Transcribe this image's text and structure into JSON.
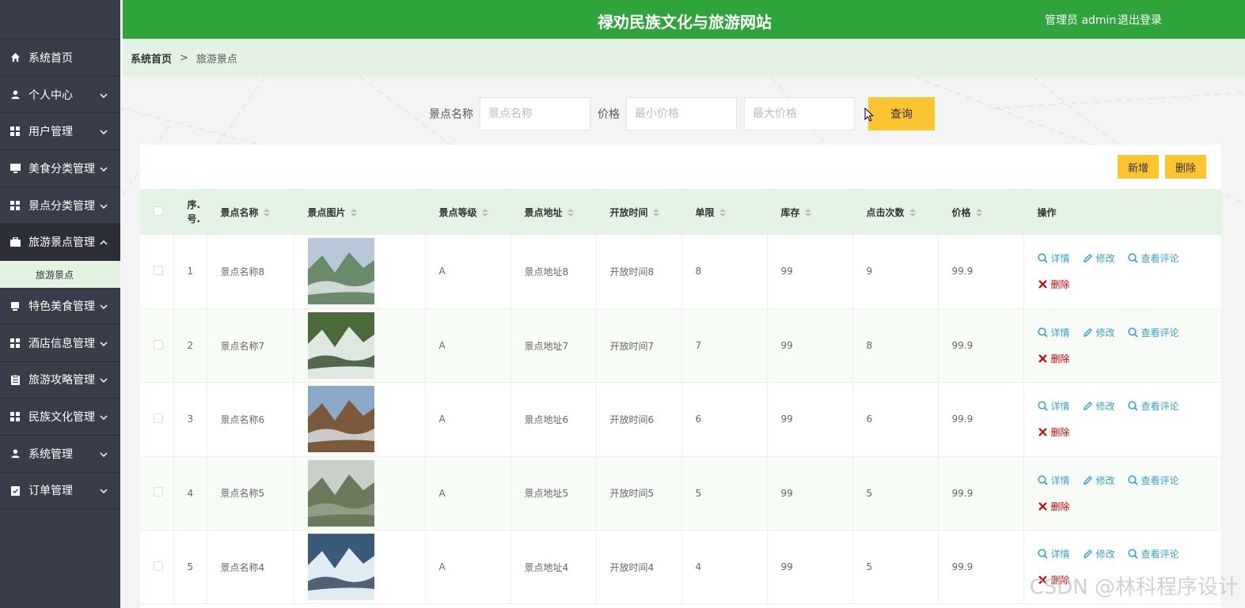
{
  "header": {
    "title": "禄劝民族文化与旅游网站",
    "user": "管理员 admin",
    "logout": "退出登录"
  },
  "sidebar": {
    "items": [
      {
        "label": "系统首页",
        "icon": "home-icon",
        "chevron": false
      },
      {
        "label": "个人中心",
        "icon": "user-icon",
        "chevron": true
      },
      {
        "label": "用户管理",
        "icon": "grid-icon",
        "chevron": true
      },
      {
        "label": "美食分类管理",
        "icon": "monitor-icon",
        "chevron": true
      },
      {
        "label": "景点分类管理",
        "icon": "grid-icon",
        "chevron": true
      },
      {
        "label": "旅游景点管理",
        "icon": "briefcase-icon",
        "chevron": true,
        "expanded": true
      },
      {
        "label": "特色美食管理",
        "icon": "card-icon",
        "chevron": true
      },
      {
        "label": "酒店信息管理",
        "icon": "grid-icon",
        "chevron": true
      },
      {
        "label": "旅游攻略管理",
        "icon": "clipboard-icon",
        "chevron": true
      },
      {
        "label": "民族文化管理",
        "icon": "grid-icon",
        "chevron": true
      },
      {
        "label": "系统管理",
        "icon": "user-icon",
        "chevron": true
      },
      {
        "label": "订单管理",
        "icon": "clipboard-check-icon",
        "chevron": true
      }
    ],
    "sub_item": "旅游景点"
  },
  "breadcrumb": {
    "home": "系统首页",
    "separator": ">",
    "current": "旅游景点"
  },
  "search": {
    "name_label": "景点名称",
    "name_placeholder": "景点名称",
    "price_label": "价格",
    "min_placeholder": "最小价格",
    "max_placeholder": "最大价格",
    "query_button": "查询"
  },
  "actions": {
    "add": "新增",
    "delete": "删除"
  },
  "table": {
    "columns": [
      "序.号.",
      "景点名称",
      "景点图片",
      "景点等级",
      "景点地址",
      "开放时间",
      "单限",
      "库存",
      "点击次数",
      "价格",
      "操作"
    ],
    "rows": [
      {
        "index": "1",
        "name": "景点名称8",
        "grade": "A",
        "address": "景点地址8",
        "open_time": "开放时间8",
        "limit": "8",
        "stock": "99",
        "clicks": "9",
        "price": "99.9"
      },
      {
        "index": "2",
        "name": "景点名称7",
        "grade": "A",
        "address": "景点地址7",
        "open_time": "开放时间7",
        "limit": "7",
        "stock": "99",
        "clicks": "8",
        "price": "99.9"
      },
      {
        "index": "3",
        "name": "景点名称6",
        "grade": "A",
        "address": "景点地址6",
        "open_time": "开放时间6",
        "limit": "6",
        "stock": "99",
        "clicks": "6",
        "price": "99.9"
      },
      {
        "index": "4",
        "name": "景点名称5",
        "grade": "A",
        "address": "景点地址5",
        "open_time": "开放时间5",
        "limit": "5",
        "stock": "99",
        "clicks": "5",
        "price": "99.9"
      },
      {
        "index": "5",
        "name": "景点名称4",
        "grade": "A",
        "address": "景点地址4",
        "open_time": "开放时间4",
        "limit": "4",
        "stock": "99",
        "clicks": "5",
        "price": "99.9"
      }
    ],
    "row_ops": {
      "detail": "详情",
      "edit": "修改",
      "comments": "查看评论",
      "delete": "删除"
    }
  },
  "watermark": "CSDN @林科程序设计",
  "colors": {
    "header_green": "#2ea43a",
    "sidebar_dark": "#393d49",
    "accent_yellow": "#fbc531",
    "link_blue": "#3aa0d0",
    "delete_red": "#cc0000"
  }
}
